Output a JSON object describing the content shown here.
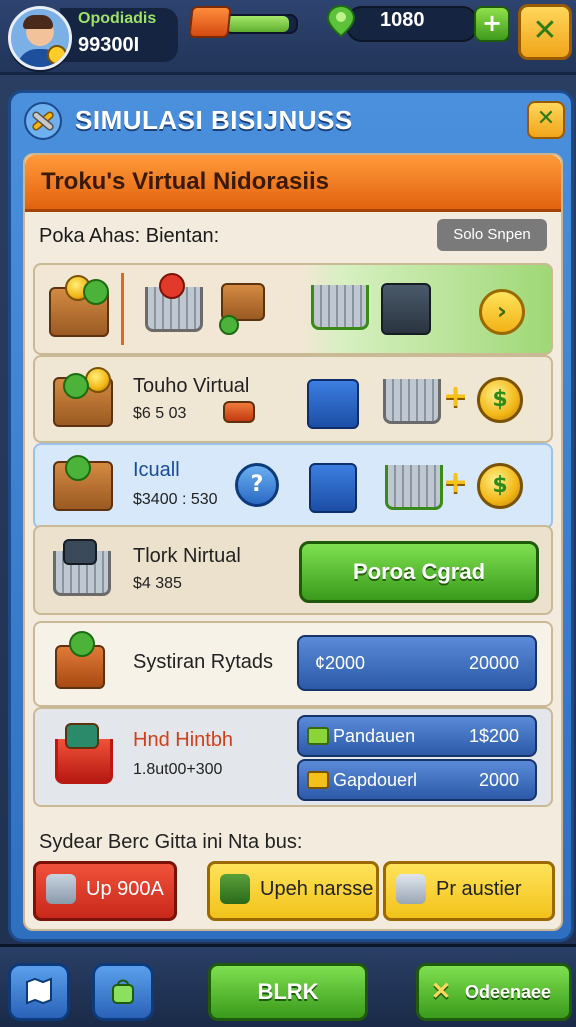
{
  "topbar": {
    "profile_name": "Opodiadis",
    "profile_value": "99300I",
    "xp_progress": 0.9,
    "currency_value": "1080",
    "plus_label": "+",
    "close_label": "✕"
  },
  "panel": {
    "title": "SIMULASI BISIJNUSS",
    "close_label": "✕",
    "banner": "Troku's Virtual Nidorasiis",
    "section_label": "Poka Ahas: Bientan:",
    "sort_button": "Solo Snpen"
  },
  "rows": [
    {
      "title": "",
      "price": ""
    },
    {
      "title": "Touho Virtual",
      "price": "$6 5 03"
    },
    {
      "title": "Icuall",
      "price": "$3400 : 530",
      "info": "?"
    },
    {
      "title": "Tlork Nirtual",
      "price": "$4 385",
      "button": "Poroa Cgrad"
    },
    {
      "title": "Systiran Rytads",
      "pill_left": "¢2000",
      "pill_right": "20000"
    },
    {
      "title": "Hnd Hintbh",
      "price": "1.8ut00+300",
      "pill1_label": "Pandauen",
      "pill1_value": "1$200",
      "pill2_label": "Gapdouerl",
      "pill2_value": "2000"
    }
  ],
  "actions": {
    "label": "Sydear Berc Gitta ini Nta bus:",
    "buttons": [
      "Up 900A",
      "Upeh narsse",
      "Pr austier"
    ]
  },
  "bottombar": {
    "center_label": "BLRK",
    "right_label": "Odeenaee"
  },
  "colors": {
    "accent_blue": "#2f6fc0",
    "accent_orange": "#e2620e",
    "accent_green": "#3a9a1c",
    "accent_yellow": "#f2c21a",
    "accent_red": "#c8281a"
  },
  "icons": [
    "avatar",
    "xp-crate-icon",
    "gem-pin-icon",
    "plus-icon",
    "close-icon",
    "wrench-icon",
    "crate-icon",
    "cart-icon",
    "coin-icon",
    "info-icon",
    "arrow-icon",
    "map-icon",
    "bag-icon",
    "star-icon"
  ]
}
